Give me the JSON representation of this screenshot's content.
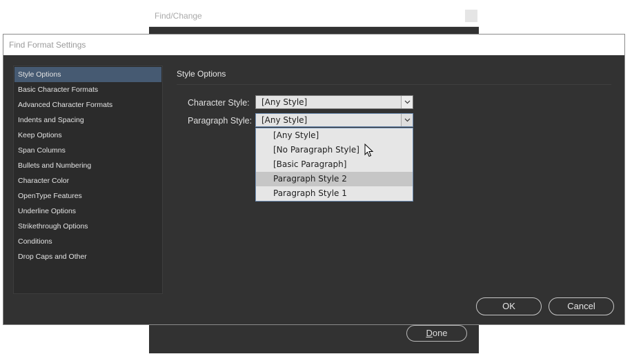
{
  "background_window": {
    "title": "Find/Change",
    "done_label_accel": "D",
    "done_label_rest": "one"
  },
  "dialog": {
    "title": "Find Format Settings",
    "sidebar": {
      "items": [
        {
          "label": "Style Options",
          "selected": true
        },
        {
          "label": "Basic Character Formats"
        },
        {
          "label": "Advanced Character Formats"
        },
        {
          "label": "Indents and Spacing"
        },
        {
          "label": "Keep Options"
        },
        {
          "label": "Span Columns"
        },
        {
          "label": "Bullets and Numbering"
        },
        {
          "label": "Character Color"
        },
        {
          "label": "OpenType Features"
        },
        {
          "label": "Underline Options"
        },
        {
          "label": "Strikethrough Options"
        },
        {
          "label": "Conditions"
        },
        {
          "label": "Drop Caps and Other"
        }
      ]
    },
    "section_title": "Style Options",
    "character_style": {
      "label": "Character Style:",
      "value": "[Any Style]"
    },
    "paragraph_style": {
      "label": "Paragraph Style:",
      "value": "[Any Style]",
      "options": [
        {
          "label": "[Any Style]"
        },
        {
          "label": "[No Paragraph Style]"
        },
        {
          "label": "[Basic Paragraph]"
        },
        {
          "label": "Paragraph Style 2",
          "hovered": true
        },
        {
          "label": "Paragraph Style 1"
        }
      ]
    },
    "ok_label": "OK",
    "cancel_label": "Cancel"
  },
  "colors": {
    "panel_bg": "#323232",
    "selection": "#465a72",
    "dropdown_hover": "#c6c6c6"
  }
}
